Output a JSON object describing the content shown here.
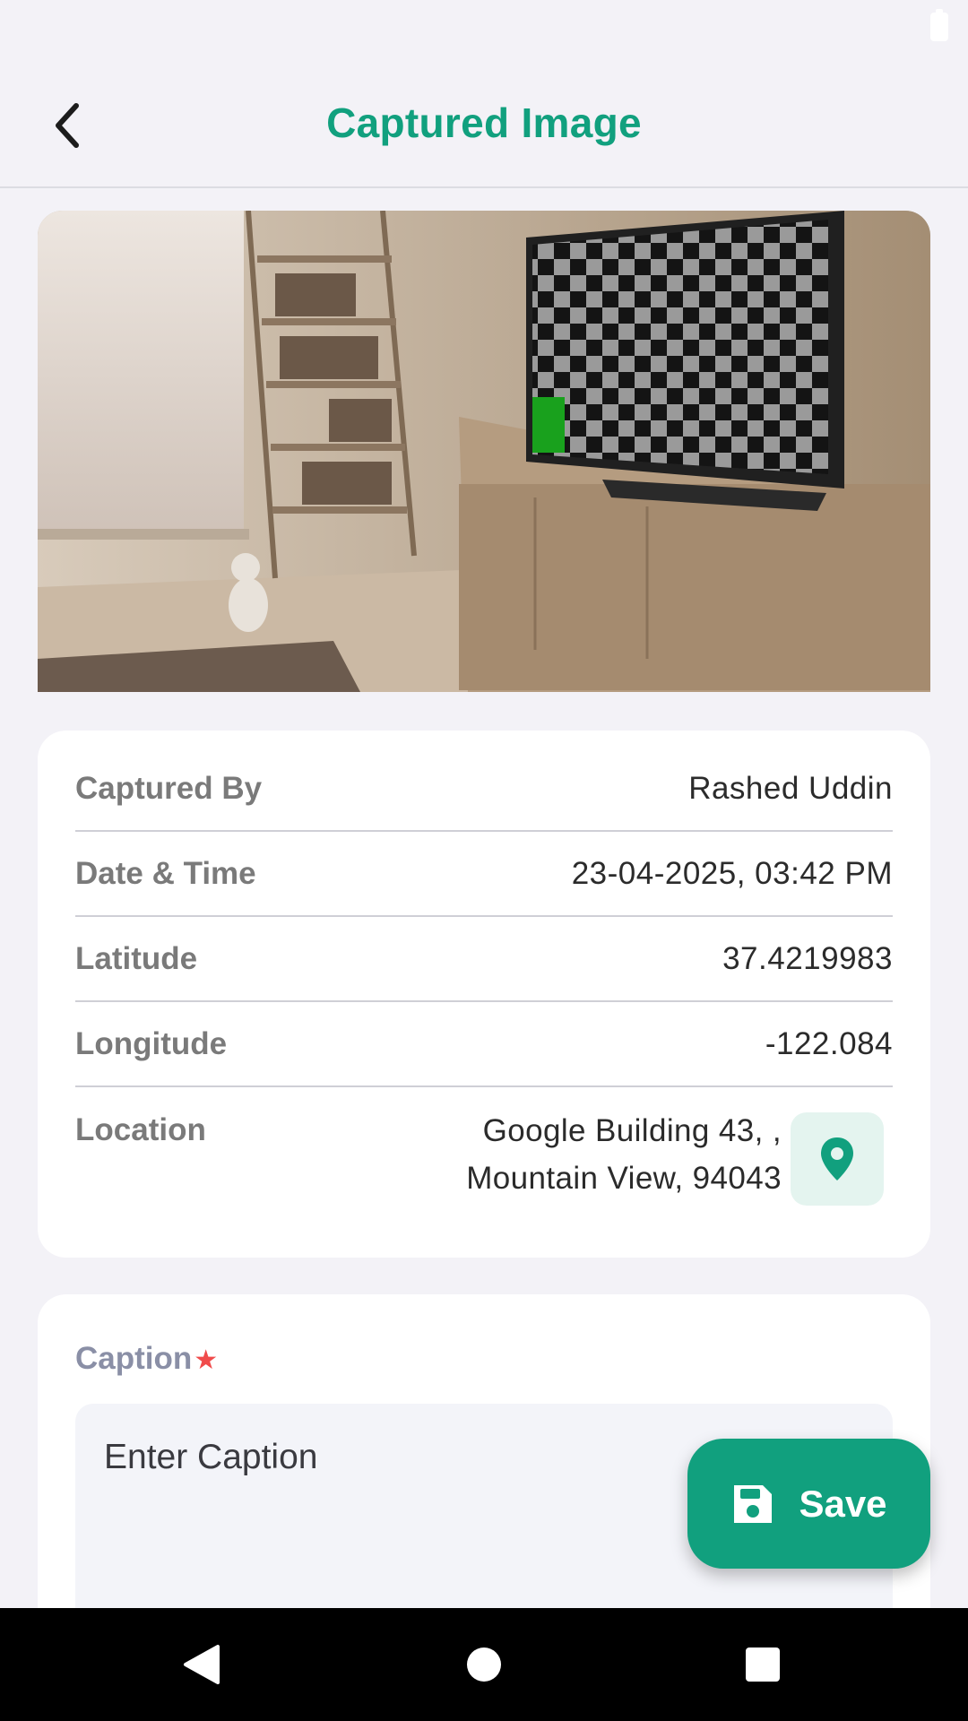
{
  "app": {
    "title": "Captured Image",
    "accent_color": "#11a07e"
  },
  "icons": {
    "back": "chevron-left-icon",
    "location": "map-pin-icon",
    "save": "floppy-disk-icon"
  },
  "details": {
    "captured_by": {
      "label": "Captured By",
      "value": "Rashed Uddin"
    },
    "date_time": {
      "label": "Date & Time",
      "value": "23-04-2025, 03:42 PM"
    },
    "latitude": {
      "label": "Latitude",
      "value": "37.4219983"
    },
    "longitude": {
      "label": "Longitude",
      "value": "-122.084"
    },
    "location": {
      "label": "Location",
      "line1": "Google Building 43, ,",
      "line2": "Mountain View, 94043"
    }
  },
  "caption": {
    "label": "Caption",
    "required_mark": "★",
    "placeholder": "Enter Caption",
    "value": ""
  },
  "save_button": {
    "label": "Save"
  },
  "nav": {
    "back": "triangle-back-icon",
    "home": "circle-home-icon",
    "recents": "square-recents-icon"
  }
}
